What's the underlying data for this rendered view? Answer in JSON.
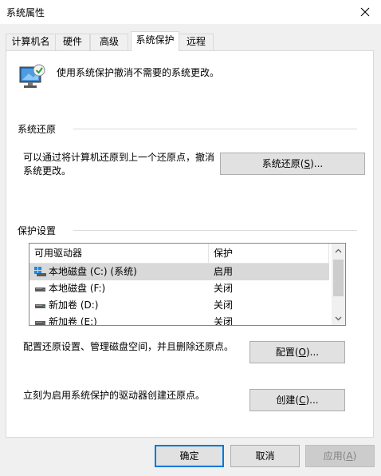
{
  "window": {
    "title": "系统属性"
  },
  "tabs": [
    {
      "label": "计算机名",
      "active": false
    },
    {
      "label": "硬件",
      "active": false
    },
    {
      "label": "高级",
      "active": false
    },
    {
      "label": "系统保护",
      "active": true
    },
    {
      "label": "远程",
      "active": false
    }
  ],
  "intro_text": "使用系统保护撤消不需要的系统更改。",
  "system_restore": {
    "heading": "系统还原",
    "description": "可以通过将计算机还原到上一个还原点，撤消系统更改。",
    "button": {
      "text": "系统还原(",
      "mnemonic": "S",
      "suffix": ")..."
    }
  },
  "protection": {
    "heading": "保护设置",
    "columns": [
      "可用驱动器",
      "保护"
    ],
    "drives": [
      {
        "name": "本地磁盘 (C:) (系统)",
        "protection": "启用",
        "selected": true,
        "icon": "system-drive-icon"
      },
      {
        "name": "本地磁盘 (F:)",
        "protection": "关闭",
        "selected": false,
        "icon": "drive-icon"
      },
      {
        "name": "新加卷 (D:)",
        "protection": "关闭",
        "selected": false,
        "icon": "drive-icon"
      },
      {
        "name": "新加卷 (E:)",
        "protection": "关闭",
        "selected": false,
        "icon": "drive-icon"
      }
    ],
    "configure_text": "配置还原设置、管理磁盘空间，并且删除还原点。",
    "configure_button": {
      "text": "配置(",
      "mnemonic": "O",
      "suffix": ")..."
    },
    "create_text": "立刻为启用系统保护的驱动器创建还原点。",
    "create_button": {
      "text": "创建(",
      "mnemonic": "C",
      "suffix": ")..."
    }
  },
  "footer": {
    "ok": "确定",
    "cancel": "取消",
    "apply": {
      "text": "应用(",
      "mnemonic": "A",
      "suffix": ")"
    }
  },
  "colors": {
    "accent": "#0078d7",
    "window_bg": "#f0f0f0",
    "selected_row": "#d9d9d9"
  }
}
